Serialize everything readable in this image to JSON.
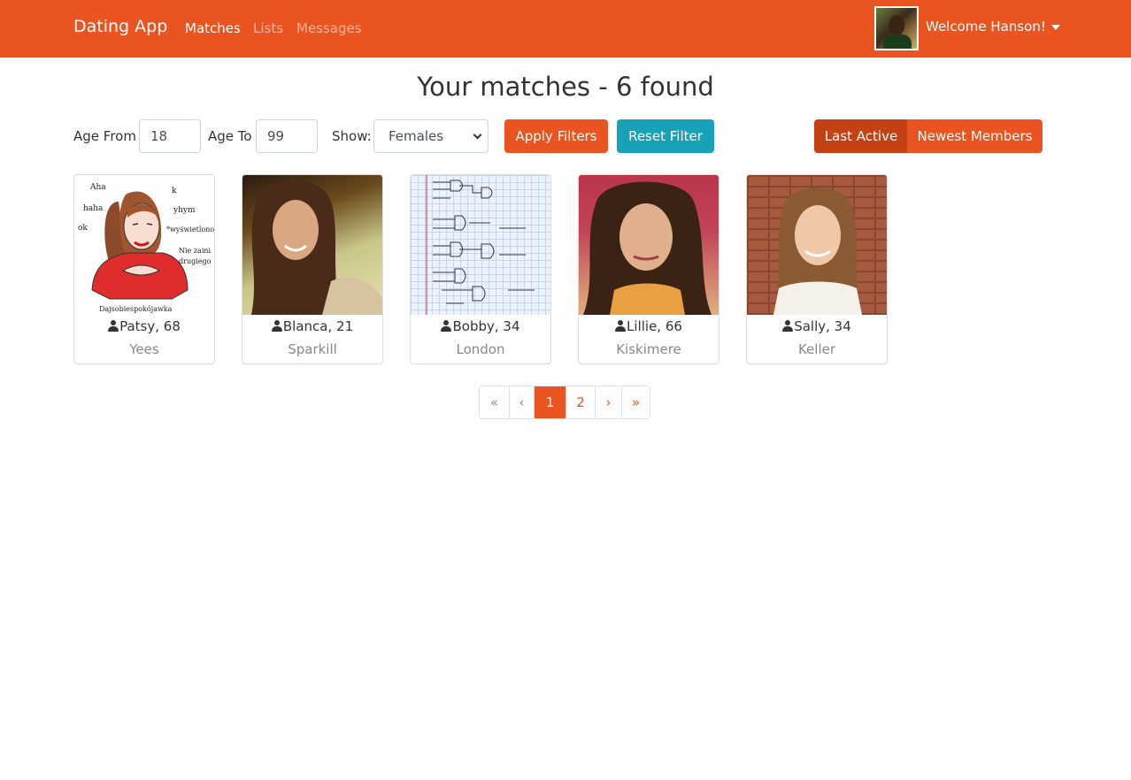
{
  "nav": {
    "brand": "Dating App",
    "links": [
      {
        "label": "Matches",
        "active": true
      },
      {
        "label": "Lists",
        "active": false
      },
      {
        "label": "Messages",
        "active": false
      }
    ],
    "welcome": "Welcome Hanson!"
  },
  "page": {
    "title": "Your matches - 6 found"
  },
  "filters": {
    "age_from_label": "Age From",
    "age_from_value": "18",
    "age_to_label": "Age To",
    "age_to_value": "99",
    "show_label": "Show:",
    "show_value": "Females",
    "apply_label": "Apply Filters",
    "reset_label": "Reset Filter",
    "sort_last_active": "Last Active",
    "sort_newest": "Newest Members"
  },
  "members": [
    {
      "name": "Patsy, 68",
      "city": "Yees"
    },
    {
      "name": "Blanca, 21",
      "city": "Sparkill"
    },
    {
      "name": "Bobby, 34",
      "city": "London"
    },
    {
      "name": "Lillie, 66",
      "city": "Kiskimere"
    },
    {
      "name": "Sally, 34",
      "city": "Keller"
    }
  ],
  "meme_text": {
    "aha": "Aha",
    "haha": "haha",
    "ok": "ok",
    "k": "k",
    "yhym": "yhym",
    "wys": "*wyświetlono",
    "nie": "Nie zaini",
    "drugiego": "drugiego",
    "bottom": "Dajsobiespokójawka"
  },
  "pagination": {
    "first": "«",
    "prev": "‹",
    "pages": [
      "1",
      "2"
    ],
    "next": "›",
    "last": "»",
    "current": "1"
  },
  "colors": {
    "primary": "#e95420",
    "info": "#17a2b8",
    "active_sort": "#c34113"
  }
}
